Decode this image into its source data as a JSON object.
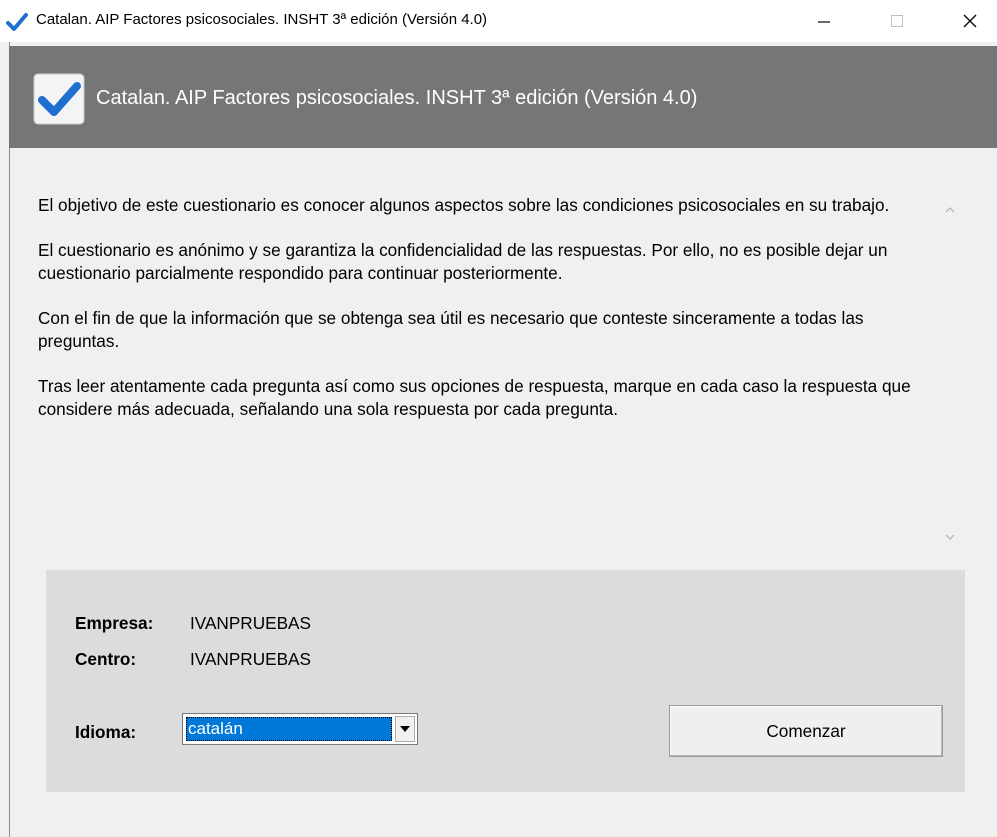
{
  "window": {
    "title": "Catalan. AIP Factores psicosociales. INSHT 3ª edición (Versión 4.0)",
    "controls": {
      "minimize": "minimize-icon",
      "maximize": "maximize-icon",
      "close": "close-icon"
    }
  },
  "header": {
    "title": "Catalan. AIP Factores psicosociales. INSHT 3ª edición (Versión 4.0)",
    "icon": "checkbox-checked-icon"
  },
  "intro": {
    "paragraphs": [
      "El objetivo de este cuestionario es conocer algunos aspectos sobre las condiciones psicosociales en su trabajo.",
      "El cuestionario es anónimo y se garantiza la confidencialidad de las respuestas. Por ello, no es posible dejar un cuestionario parcialmente respondido para continuar posteriormente.",
      "Con el fin de que la información que se obtenga sea útil es necesario que conteste sinceramente a todas las preguntas.",
      "Tras leer atentamente cada pregunta así como sus opciones de respuesta, marque en cada caso la respuesta que considere más adecuada, señalando una sola respuesta por cada pregunta."
    ]
  },
  "form": {
    "empresa_label": "Empresa:",
    "empresa_value": "IVANPRUEBAS",
    "centro_label": "Centro:",
    "centro_value": "IVANPRUEBAS",
    "idioma_label": "Idioma:",
    "idioma_value": "catalán",
    "start_button": "Comenzar"
  },
  "colors": {
    "header_bg": "#767676",
    "panel_bg": "#dcdcdc",
    "selection": "#0078d7",
    "check_blue": "#1e6fd0"
  }
}
